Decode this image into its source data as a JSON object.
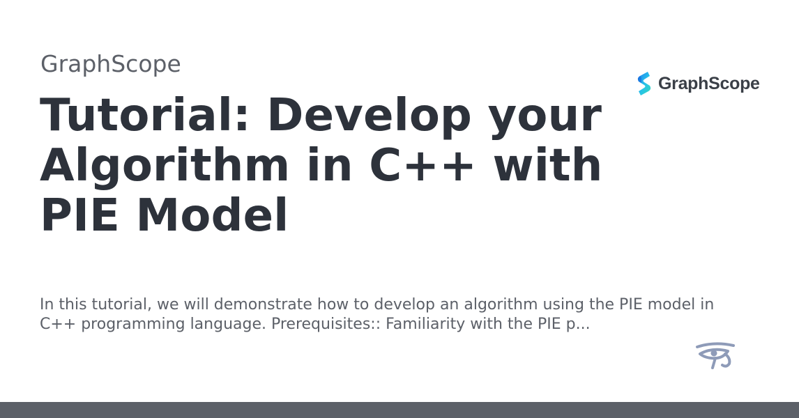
{
  "site": {
    "name": "GraphScope"
  },
  "article": {
    "title": "Tutorial: Develop your Algorithm in C++ with PIE Model",
    "description": "In this tutorial, we will demonstrate how to develop an algorithm using the PIE model in C++ programming language. Prerequisites:: Familiarity with the PIE p..."
  },
  "logo": {
    "text": "GraphScope",
    "icon": "graphscope-logo-icon",
    "colors": [
      "#1e7cf2",
      "#27c4e8",
      "#35d6b8"
    ]
  },
  "footer_icon": {
    "icon": "eye-of-horus-icon",
    "color": "#8e9bb8"
  },
  "colors": {
    "background": "#ffffff",
    "title": "#2d323b",
    "muted_text": "#5c6068",
    "footer_bar": "#5c6068"
  }
}
